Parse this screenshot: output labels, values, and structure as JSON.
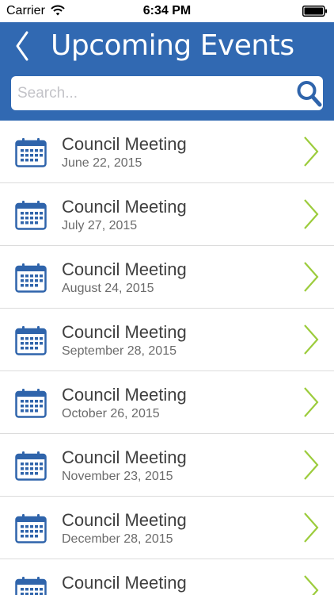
{
  "status_bar": {
    "carrier": "Carrier",
    "time": "6:34 PM"
  },
  "header": {
    "title": "Upcoming Events",
    "back_icon": "chevron-left-icon"
  },
  "search": {
    "placeholder": "Search...",
    "value": "",
    "icon": "search-icon"
  },
  "colors": {
    "header_bg": "#3169b2",
    "calendar_icon": "#2f64ab",
    "chevron": "#9ccc3c",
    "title_text": "#3f3f3f",
    "date_text": "#6b6b6b"
  },
  "events": [
    {
      "title": "Council Meeting",
      "date": "June 22, 2015"
    },
    {
      "title": "Council Meeting",
      "date": "July 27, 2015"
    },
    {
      "title": "Council Meeting",
      "date": "August 24, 2015"
    },
    {
      "title": "Council Meeting",
      "date": "September 28, 2015"
    },
    {
      "title": "Council Meeting",
      "date": "October 26, 2015"
    },
    {
      "title": "Council Meeting",
      "date": "November 23, 2015"
    },
    {
      "title": "Council Meeting",
      "date": "December 28, 2015"
    },
    {
      "title": "Council Meeting",
      "date": ""
    }
  ]
}
